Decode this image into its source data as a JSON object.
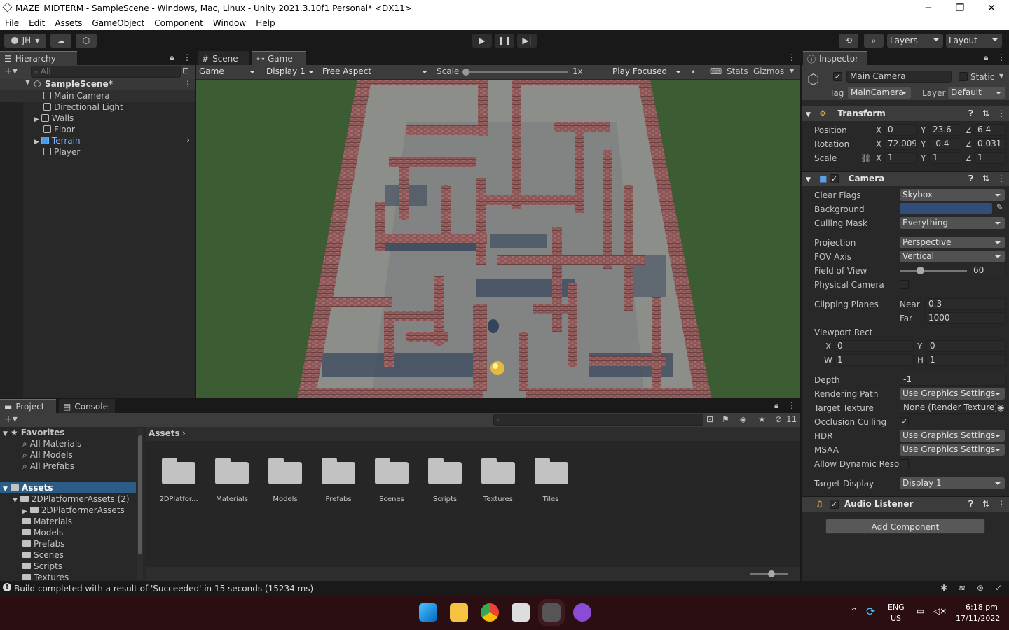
{
  "window": {
    "title": "MAZE_MIDTERM - SampleScene - Windows, Mac, Linux - Unity 2021.3.10f1 Personal* <DX11>",
    "min": "─",
    "max": "❐",
    "close": "✕"
  },
  "menu": [
    "File",
    "Edit",
    "Assets",
    "GameObject",
    "Component",
    "Window",
    "Help"
  ],
  "toolbar": {
    "account": "JH",
    "layers": "Layers",
    "layout": "Layout"
  },
  "hierarchy": {
    "tab": "Hierarchy",
    "search_placeholder": "All",
    "scene": "SampleScene*",
    "items": [
      "Main Camera",
      "Directional Light",
      "Walls",
      "Floor",
      "Terrain",
      "Player"
    ]
  },
  "game_view": {
    "tab_scene": "Scene",
    "tab_game": "Game",
    "mode": "Game",
    "display": "Display 1",
    "aspect": "Free Aspect",
    "scale_label": "Scale",
    "scale_value": "1x",
    "scale_level": 0,
    "play_mode": "Play Focused",
    "stats": "Stats",
    "gizmos": "Gizmos"
  },
  "project": {
    "tab_project": "Project",
    "tab_console": "Console",
    "hidden_count": "11",
    "favorites": "Favorites",
    "fav_items": [
      "All Materials",
      "All Models",
      "All Prefabs"
    ],
    "assets_root": "Assets",
    "tree": [
      "2DPlatformerAssets (2)",
      "2DPlatformerAssets",
      "Materials",
      "Models",
      "Prefabs",
      "Scenes",
      "Scripts",
      "Textures"
    ],
    "breadcrumb": "Assets",
    "folders": [
      "2DPlatfor...",
      "Materials",
      "Models",
      "Prefabs",
      "Scenes",
      "Scripts",
      "Textures",
      "Tiles"
    ]
  },
  "inspector": {
    "tab": "Inspector",
    "object_name": "Main Camera",
    "static": "Static",
    "tag_label": "Tag",
    "tag": "MainCamera",
    "layer_label": "Layer",
    "layer": "Default",
    "transform": {
      "title": "Transform",
      "position_label": "Position",
      "pos": [
        "0",
        "23.6",
        "6.4"
      ],
      "rotation_label": "Rotation",
      "rot": [
        "72.009",
        "-0.4",
        "0.031"
      ],
      "scale_label": "Scale",
      "scl": [
        "1",
        "1",
        "1"
      ],
      "axis": [
        "X",
        "Y",
        "Z"
      ]
    },
    "camera": {
      "title": "Camera",
      "clear_flags_label": "Clear Flags",
      "clear_flags": "Skybox",
      "background_label": "Background",
      "background_color": "#314d79",
      "culling_mask_label": "Culling Mask",
      "culling_mask": "Everything",
      "projection_label": "Projection",
      "projection": "Perspective",
      "fov_axis_label": "FOV Axis",
      "fov_axis": "Vertical",
      "fov_label": "Field of View",
      "fov": "60",
      "fov_level": 0.3,
      "physical_label": "Physical Camera",
      "clipping_label": "Clipping Planes",
      "near_label": "Near",
      "near": "0.3",
      "far_label": "Far",
      "far": "1000",
      "viewport_label": "Viewport Rect",
      "vx_label": "X",
      "vx": "0",
      "vy_label": "Y",
      "vy": "0",
      "vw_label": "W",
      "vw": "1",
      "vh_label": "H",
      "vh": "1",
      "depth_label": "Depth",
      "depth": "-1",
      "rendering_path_label": "Rendering Path",
      "rendering_path": "Use Graphics Settings",
      "target_texture_label": "Target Texture",
      "target_texture": "None (Render Texture)",
      "occlusion_label": "Occlusion Culling",
      "hdr_label": "HDR",
      "hdr": "Use Graphics Settings",
      "msaa_label": "MSAA",
      "msaa": "Use Graphics Settings",
      "dynres_label": "Allow Dynamic Resol",
      "target_display_label": "Target Display",
      "target_display": "Display 1"
    },
    "audio_listener": "Audio Listener",
    "add_component": "Add Component"
  },
  "status": "Build completed with a result of 'Succeeded' in 15 seconds (15234 ms)",
  "taskbar": {
    "lang": "ENG",
    "region": "US",
    "time": "6:18 pm",
    "date": "17/11/2022"
  }
}
